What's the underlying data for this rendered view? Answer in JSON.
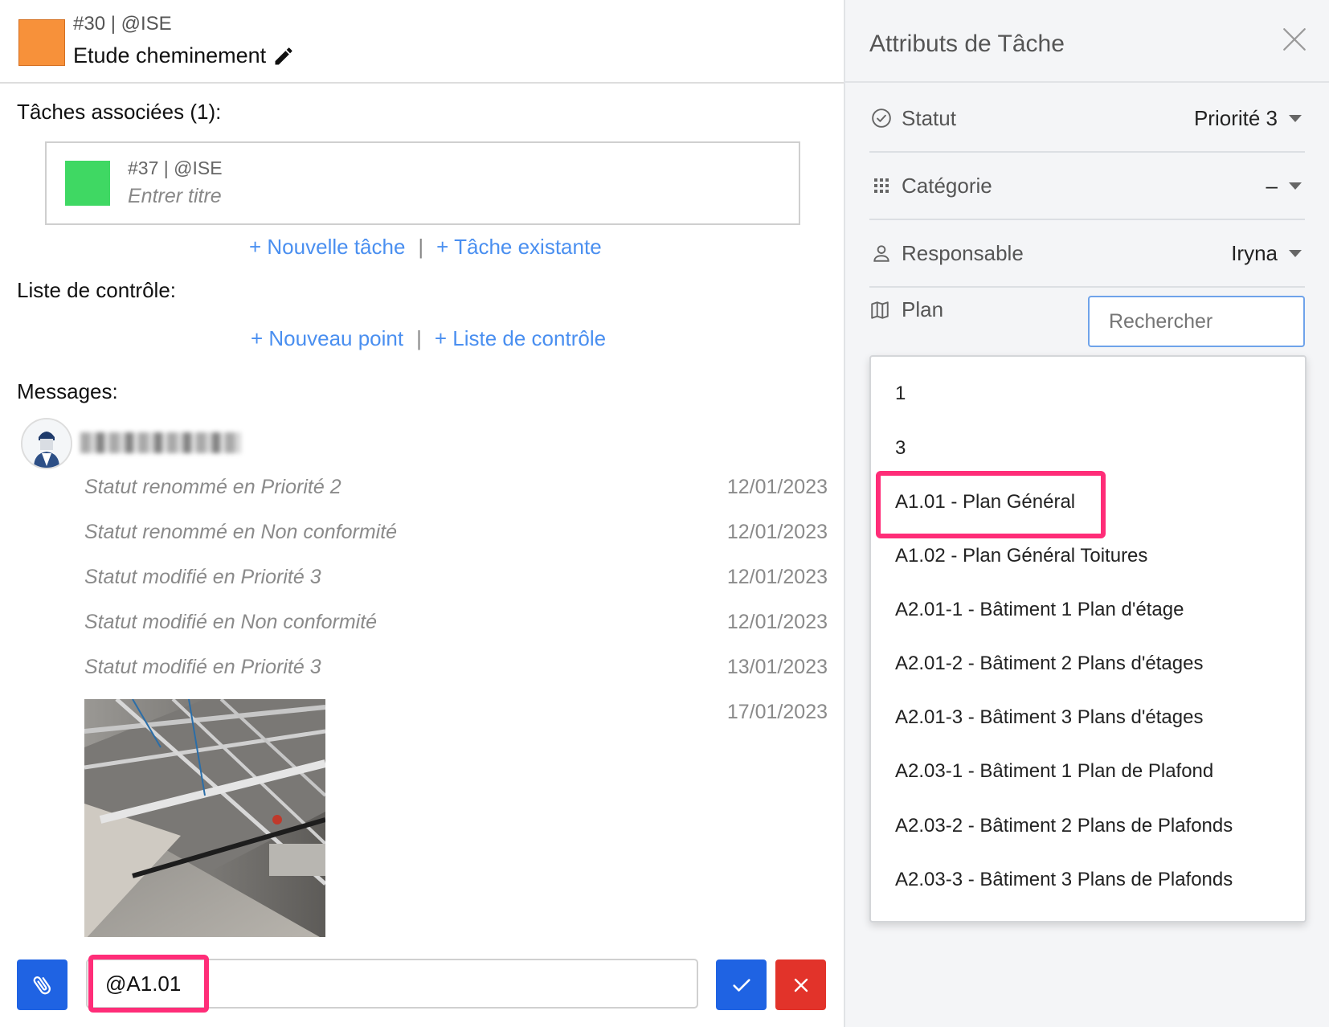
{
  "task": {
    "meta": "#30 | @ISE",
    "title": "Etude cheminement",
    "color": "#f7913a"
  },
  "related": {
    "heading": "Tâches associées (1):",
    "items": [
      {
        "meta": "#37 | @ISE",
        "title_placeholder": "Entrer titre",
        "color": "#3fd863"
      }
    ],
    "new_task": "+ Nouvelle tâche",
    "existing_task": "+ Tâche existante",
    "separator": "|"
  },
  "checklist": {
    "heading": "Liste de contrôle:",
    "new_point": "+ Nouveau point",
    "checklist_link": "+ Liste de contrôle",
    "separator": "|"
  },
  "messages": {
    "heading": "Messages:",
    "entries": [
      {
        "text": "Statut renommé en Priorité 2",
        "date": "12/01/2023"
      },
      {
        "text": "Statut renommé en Non conformité",
        "date": "12/01/2023"
      },
      {
        "text": "Statut modifié en Priorité 3",
        "date": "12/01/2023"
      },
      {
        "text": "Statut modifié en Non conformité",
        "date": "12/01/2023"
      },
      {
        "text": "Statut modifié en Priorité 3",
        "date": "13/01/2023"
      }
    ],
    "photo_date": "17/01/2023",
    "input_value": "@A1.01"
  },
  "panel": {
    "title": "Attributs de Tâche",
    "attributes": [
      {
        "label": "Statut",
        "value": "Priorité 3",
        "icon": "check-circle-icon"
      },
      {
        "label": "Catégorie",
        "value": "–",
        "icon": "grid-icon"
      },
      {
        "label": "Responsable",
        "value": "Iryna",
        "icon": "person-icon"
      }
    ],
    "plan": {
      "label": "Plan",
      "icon": "map-icon",
      "search_placeholder": "Rechercher",
      "options": [
        "1",
        "3",
        "A1.01 - Plan Général",
        "A1.02 - Plan Général Toitures",
        "A2.01-1 - Bâtiment 1 Plan d'étage",
        "A2.01-2 - Bâtiment 2 Plans d'étages",
        "A2.01-3 - Bâtiment 3 Plans d'étages",
        "A2.03-1 - Bâtiment 1 Plan de Plafond",
        "A2.03-2 - Bâtiment 2 Plans de Plafonds",
        "A2.03-3 - Bâtiment 3 Plans de Plafonds"
      ],
      "highlighted_option_index": 2
    }
  },
  "colors": {
    "accent_blue": "#1f63e3",
    "link_blue": "#4a8ff0",
    "danger_red": "#e2332a",
    "highlight_pink": "#ff2d78"
  }
}
